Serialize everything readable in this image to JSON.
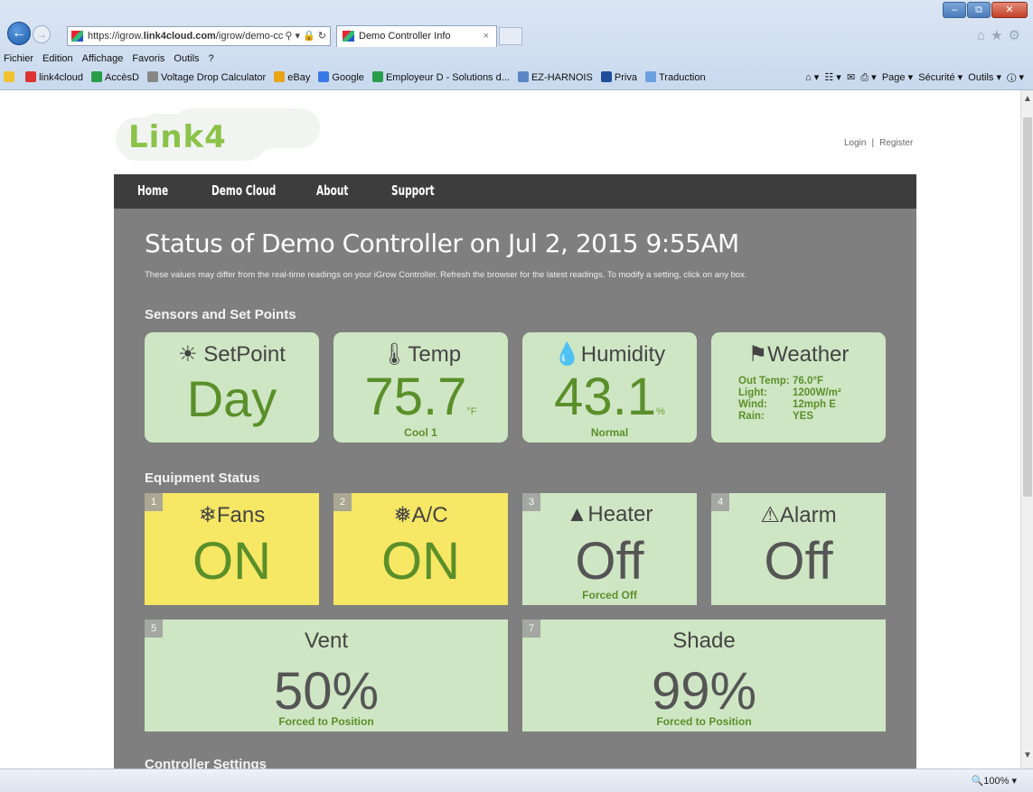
{
  "browser": {
    "url": "https://igrow.link4cloud.com/igrow/demo-cc",
    "url_host": "https://igrow.",
    "url_host_bold": "link4cloud.com",
    "url_rest": "/igrow/demo-cc",
    "tab_title": "Demo Controller Info",
    "menu": [
      "Fichier",
      "Edition",
      "Affichage",
      "Favoris",
      "Outils",
      "?"
    ],
    "favorites": [
      "link4cloud",
      "AccèsD",
      "Voltage Drop Calculator",
      "eBay",
      "Google",
      "Employeur D - Solutions d...",
      "EZ-HARNOIS",
      "Priva",
      "Traduction"
    ],
    "tools": [
      "Page ▾",
      "Sécurité ▾",
      "Outils ▾"
    ],
    "zoom": "100%"
  },
  "logo": {
    "text": "Link4"
  },
  "auth": {
    "login": "Login",
    "register": "Register"
  },
  "nav": [
    "Home",
    "Demo Cloud",
    "About",
    "Support"
  ],
  "status": {
    "title": "Status of Demo Controller on Jul 2, 2015 9:55AM",
    "subtitle": "These values may differ from the real-time readings on your iGrow Controller. Refresh the browser for the latest readings. To modify a setting, click on any box."
  },
  "sensors": {
    "heading": "Sensors and Set Points",
    "setpoint": {
      "label": "SetPoint",
      "value": "Day"
    },
    "temp": {
      "label": "Temp",
      "value": "75.7",
      "unit": "°F",
      "note": "Cool 1"
    },
    "humidity": {
      "label": "Humidity",
      "value": "43.1",
      "unit": "%",
      "note": "Normal"
    },
    "weather": {
      "label": "Weather",
      "rows": [
        {
          "k": "Out Temp:",
          "v": "76.0°F"
        },
        {
          "k": "Light:",
          "v": "1200W/m²"
        },
        {
          "k": "Wind:",
          "v": "12mph E"
        },
        {
          "k": "Rain:",
          "v": "YES"
        }
      ]
    }
  },
  "equipment": {
    "heading": "Equipment Status",
    "fans": {
      "num": "1",
      "label": "Fans",
      "value": "ON"
    },
    "ac": {
      "num": "2",
      "label": "A/C",
      "value": "ON"
    },
    "heater": {
      "num": "3",
      "label": "Heater",
      "value": "Off",
      "note": "Forced Off"
    },
    "alarm": {
      "num": "4",
      "label": "Alarm",
      "value": "Off"
    },
    "vent": {
      "num": "5",
      "label": "Vent",
      "value": "50%",
      "level": 50,
      "note": "Forced to Position"
    },
    "shade": {
      "num": "7",
      "label": "Shade",
      "value": "99%",
      "level": 99,
      "note": "Forced to Position"
    }
  },
  "controller": {
    "heading": "Controller Settings"
  }
}
